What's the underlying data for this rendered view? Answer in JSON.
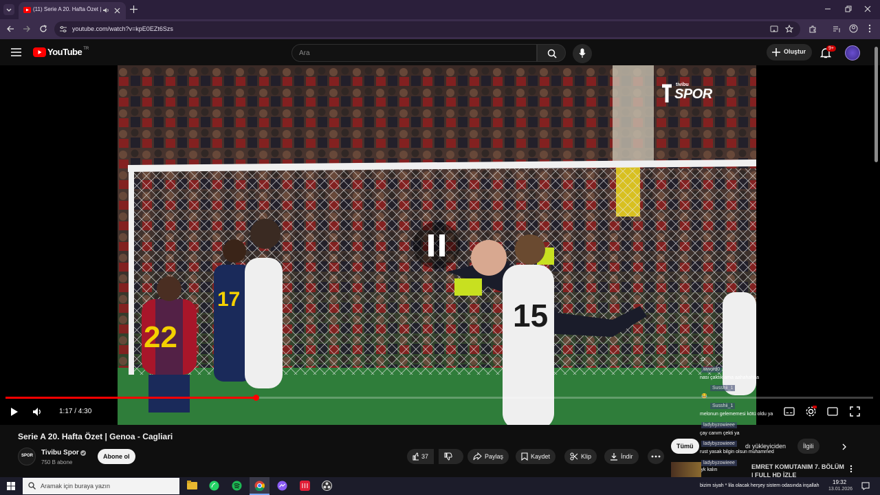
{
  "browser": {
    "tab_title": "(11) Serie A 20. Hafta Özet |",
    "url": "youtube.com/watch?v=kpE0EZt6Szs"
  },
  "youtube": {
    "logo_text": "YouTube",
    "region": "TR",
    "search_placeholder": "Ara",
    "create_label": "Oluştur",
    "notif_count": "9+"
  },
  "player": {
    "progress": 0.289,
    "time": "1:17 / 4:30",
    "watermark": "SPOR",
    "watermark_small": "tivibu",
    "state": "playing"
  },
  "chat_overlay": [
    {
      "name": "",
      "text": ":D"
    },
    {
      "name": "wword0",
      "text": "nası çaktık ama aahahahha"
    },
    {
      "name": "Susshii_1",
      "text": "😂"
    },
    {
      "name": "Susshii_1",
      "text": "melonun gelememesi kötü oldu ya"
    },
    {
      "name": "ladybyzowieee",
      "text": "çay canım çekti ya"
    },
    {
      "name": "ladybyzowieee",
      "text": "rust yasak bilgin olsun muhammed"
    },
    {
      "name": "ladybyzowieee",
      "text": "iyk kalın"
    },
    {
      "name": "ladybyzowieee",
      "text": "bizim siyah * lila olacak herşey sistem odasında inşallah"
    }
  ],
  "video": {
    "title": "Serie A 20. Hafta Özet | Genoa - Cagliari",
    "channel": "Tivibu Spor",
    "subscribers": "750 B abone",
    "subscribe_label": "Abone ol",
    "likes": "37",
    "share_label": "Paylaş",
    "save_label": "Kaydet",
    "clip_label": "Klip",
    "download_label": "İndir"
  },
  "side": {
    "chip_all": "Tümü",
    "chip_uploader": "dı yükleyiciden",
    "chip_related": "İlgili",
    "next_title": "EMRET KOMUTANIM 7. BÖLÜM",
    "next_sub": "| FULL HD İZLE"
  },
  "taskbar": {
    "search_placeholder": "Aramak için buraya yazın",
    "time": "19:32",
    "date": "13.01.2026"
  },
  "colors": {
    "accent_red": "#ff0000",
    "tab_bg": "#2b1f3b",
    "address_bg": "#3b2d4c"
  }
}
